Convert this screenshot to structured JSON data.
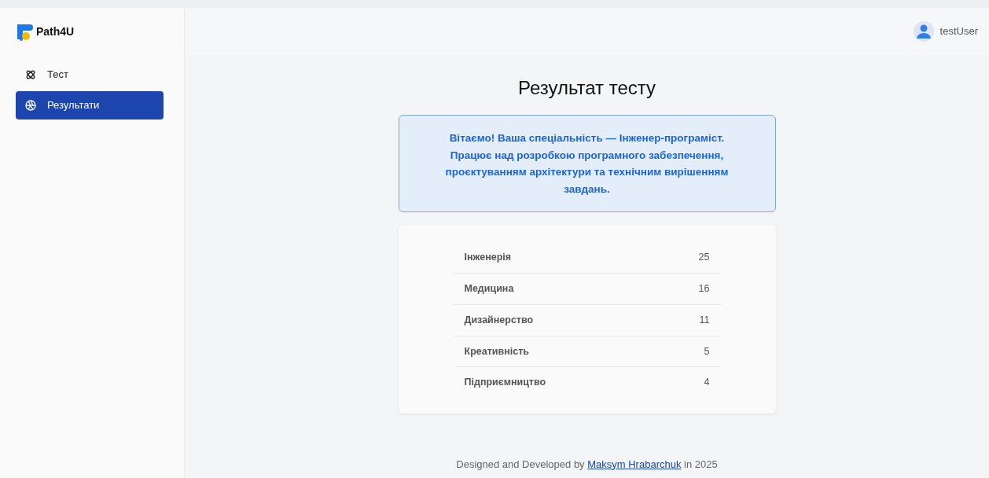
{
  "brand": {
    "name": "Path4U"
  },
  "sidebar": {
    "items": [
      {
        "label": "Тест",
        "selected": false
      },
      {
        "label": "Результати",
        "selected": true
      }
    ]
  },
  "header": {
    "user": "testUser"
  },
  "title": "Результат тесту",
  "message": "Вітаємо! Ваша спеціальність — Інженер-програміст. Працює над розробкою програмного забезпечення, проєктуванням архітектури та технічним вирішенням завдань.",
  "scores": [
    {
      "name": "Інженерія",
      "value": "25"
    },
    {
      "name": "Медицина",
      "value": "16"
    },
    {
      "name": "Дизайнерство",
      "value": "11"
    },
    {
      "name": "Креативність",
      "value": "5"
    },
    {
      "name": "Підприємництво",
      "value": "4"
    }
  ],
  "footer": {
    "before": "Designed and Developed by",
    "link": "Maksym Hrabarchuk",
    "after": "in 2025"
  }
}
